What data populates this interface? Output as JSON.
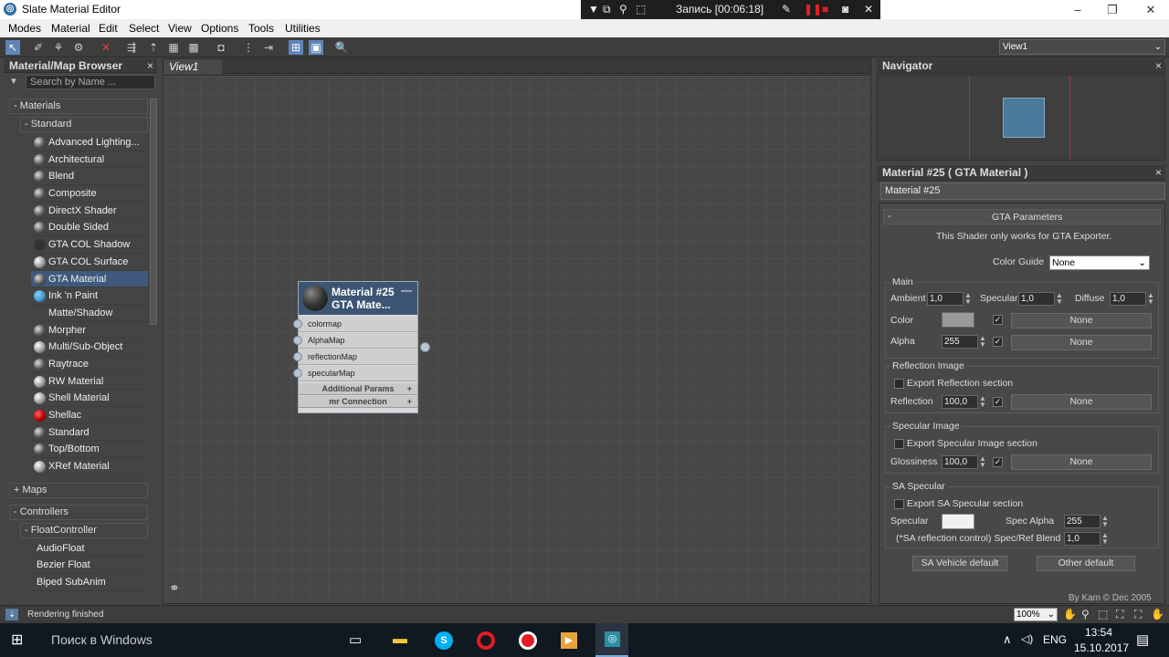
{
  "window": {
    "title": "Slate Material Editor",
    "minimize": "–",
    "maximize": "❐",
    "close": "✕"
  },
  "recorder": {
    "label": "Запись [00:06:18]"
  },
  "menu": [
    "Modes",
    "Material",
    "Edit",
    "Select",
    "View",
    "Options",
    "Tools",
    "Utilities"
  ],
  "toolbar": {
    "view_select": "View1"
  },
  "browser": {
    "title": "Material/Map Browser",
    "search_placeholder": "Search by Name ...",
    "materials_group": "- Materials",
    "standard_group": "- Standard",
    "items": [
      "Advanced Lighting...",
      "Architectural",
      "Blend",
      "Composite",
      "DirectX Shader",
      "Double Sided",
      "GTA COL Shadow",
      "GTA COL Surface",
      "GTA Material",
      "Ink 'n Paint",
      "Matte/Shadow",
      "Morpher",
      "Multi/Sub-Object",
      "Raytrace",
      "RW Material",
      "Shell Material",
      "Shellac",
      "Standard",
      "Top/Bottom",
      "XRef Material"
    ],
    "maps_group": "+ Maps",
    "controllers_group": "- Controllers",
    "float_group": "- FloatController",
    "controller_items": [
      "AudioFloat",
      "Bezier Float",
      "Biped SubAnim"
    ]
  },
  "view": {
    "tab": "View1"
  },
  "node": {
    "title1": "Material #25",
    "title2": "GTA Mate...",
    "slots": [
      "colormap",
      "AlphaMap",
      "reflectionMap",
      "specularMap"
    ],
    "rollouts": [
      "Additional Params",
      "mr Connection"
    ]
  },
  "navigator": {
    "title": "Navigator"
  },
  "params": {
    "header": "Material #25  ( GTA Material )",
    "name_value": "Material #25",
    "rollout": "GTA Parameters",
    "rollout_toggle": "-",
    "note": "This Shader only works for GTA Exporter.",
    "color_guide_label": "Color Guide",
    "color_guide_value": "None",
    "main": {
      "title": "Main",
      "ambient_label": "Ambient",
      "ambient": "1,0",
      "specular_label": "Specular",
      "specular": "1,0",
      "diffuse_label": "Diffuse",
      "diffuse": "1,0",
      "color_label": "Color",
      "color_map": "None",
      "alpha_label": "Alpha",
      "alpha": "255",
      "alpha_map": "None"
    },
    "reflection": {
      "title": "Reflection Image",
      "export": "Export Reflection section",
      "label": "Reflection",
      "value": "100,0",
      "map": "None"
    },
    "specimg": {
      "title": "Specular Image",
      "export": "Export Specular Image section",
      "label": "Glossiness",
      "value": "100,0",
      "map": "None"
    },
    "sa": {
      "title": "SA Specular",
      "export": "Export SA Specular section",
      "spec_label": "Specular",
      "alpha_label": "Spec Alpha",
      "alpha": "255",
      "blend_label": "(*SA reflection control) Spec/Ref Blend",
      "blend": "1,0"
    },
    "btn_vehicle": "SA Vehicle default",
    "btn_other": "Other default",
    "credit": "By Kam © Dec 2005"
  },
  "status": {
    "text": "Rendering finished",
    "zoom": "100%"
  },
  "taskbar": {
    "search": "Поиск в Windows",
    "lang": "ENG",
    "time": "13:54",
    "date": "15.10.2017"
  },
  "colors": {
    "accent": "#3f5a7c",
    "node_header": "#3c5572",
    "nav_box": "#4a7a9c"
  }
}
